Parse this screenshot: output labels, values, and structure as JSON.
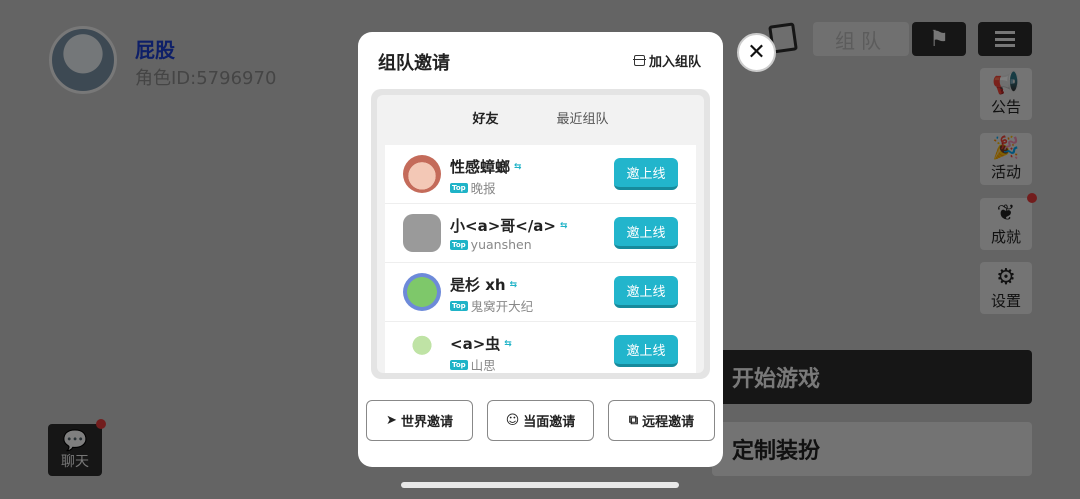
{
  "lobby": {
    "nickname": "屁股",
    "role_id": "角色ID:5796970",
    "team_label": "组队",
    "side_buttons": [
      {
        "label": "公告",
        "icon": "megaphone-icon"
      },
      {
        "label": "活动",
        "icon": "party-popper-icon"
      },
      {
        "label": "成就",
        "icon": "laurel-icon"
      },
      {
        "label": "设置",
        "icon": "gear-icon"
      }
    ],
    "start_game": "开始游戏",
    "custom_dress": "定制装扮",
    "chat": "聊天"
  },
  "modal": {
    "title": "组队邀请",
    "join_team": "加入组队",
    "tabs": [
      "好友",
      "最近组队"
    ],
    "friends": [
      {
        "name": "性感蟑螂",
        "top_badge": "Top",
        "sub": "晚报",
        "invite": "邀上线"
      },
      {
        "name": "小<a>哥</a>",
        "top_badge": "Top",
        "sub": "yuanshen",
        "invite": "邀上线"
      },
      {
        "name": "是杉 xh",
        "top_badge": "Top",
        "sub": "鬼窝开大纪",
        "invite": "邀上线"
      },
      {
        "name": "<a>虫",
        "top_badge": "Top",
        "sub": "山思",
        "invite": "邀上线"
      }
    ],
    "bottom_buttons": [
      {
        "label": "世界邀请",
        "icon": "send-icon"
      },
      {
        "label": "当面邀请",
        "icon": "face-icon"
      },
      {
        "label": "远程邀请",
        "icon": "external-link-icon"
      }
    ]
  },
  "colors": {
    "accent": "#22b5cc",
    "nickname": "#1d3fd1"
  }
}
